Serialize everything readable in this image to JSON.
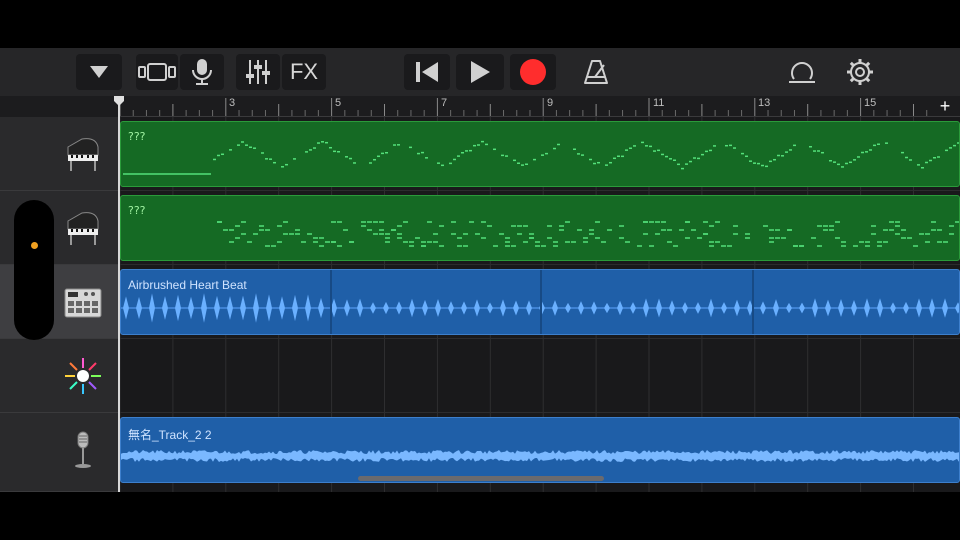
{
  "toolbar": {
    "fx_label": "FX"
  },
  "ruler": {
    "bar_numbers": [
      "3",
      "5",
      "7",
      "9",
      "11",
      "13",
      "15"
    ],
    "add_label": "+"
  },
  "tracks": [
    {
      "instrument_icon": "grand-piano-icon",
      "region_label": "???",
      "region_type": "midi",
      "color": "#156a24"
    },
    {
      "instrument_icon": "grand-piano-icon",
      "region_label": "???",
      "region_type": "midi",
      "color": "#156a24"
    },
    {
      "instrument_icon": "drum-machine-icon",
      "region_label": "Airbrushed Heart Beat",
      "region_type": "audio",
      "color": "#1f5fa8",
      "selected": true
    },
    {
      "instrument_icon": "sparkle-synth-icon",
      "region_label": "",
      "region_type": "empty"
    },
    {
      "instrument_icon": "microphone-icon",
      "region_label": "無名_Track_2 2",
      "region_type": "audio",
      "color": "#1f5fa8"
    }
  ],
  "colors": {
    "record": "#ff2d2d",
    "midi_region": "#156a24",
    "audio_region": "#1f5fa8",
    "indicator": "#f0a020"
  }
}
